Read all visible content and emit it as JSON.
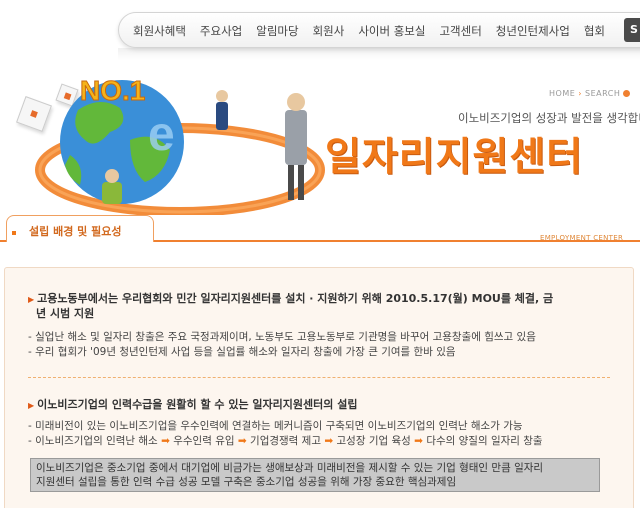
{
  "nav": {
    "items": [
      "회원사혜택",
      "주요사업",
      "알림마당",
      "회원사",
      "사이버 홍보실",
      "고객센터",
      "청년인턴제사업",
      "협회"
    ],
    "button_label": "S"
  },
  "hero": {
    "breadcrumb": [
      "HOME",
      "SEARCH"
    ],
    "slogan": "이노비즈기업의 성장과 발전을 생각합니다",
    "title": "일자리지원센터",
    "badge": "NO.1",
    "globe_letter": "e"
  },
  "section": {
    "tab_label": "설립 배경 및 필요성",
    "side_label": "EMPLOYMENT CENTER"
  },
  "content": {
    "block1": {
      "heading_line1": "고용노동부에서는 우리협회와 민간 일자리지원센터를 설치 · 지원하기 위해 2010.5.17(월) MOU를 체결, 금",
      "heading_line2": "년 시범 지원",
      "bullets": [
        "- 실업난 해소 및 일자리 창출은 주요 국정과제이며, 노동부도 고용노동부로 기관명을 바꾸어 고용창출에 힘쓰고 있음",
        "- 우리 협회가 '09년 청년인턴제 사업 등을 실업률 해소와 일자리 창출에 가장 큰 기여를 한바 있음"
      ]
    },
    "block2": {
      "heading": "이노비즈기업의 인력수급을 원활히 할 수 있는 일자리지원센터의 설립",
      "bullet1": "- 미래비전이 있는 이노비즈기업을 우수인력에 연결하는 메커니즘이 구축되면 이노비즈기업의 인력난 해소가 가능",
      "bullet2_parts": [
        "- 이노비즈기업의 인력난 해소",
        "우수인력 유입",
        "기업경쟁력 제고",
        "고성장 기업 육성",
        "다수의 양질의 일자리 창출"
      ],
      "arrow_glyph": "➡"
    },
    "highlight_line1": "이노비즈기업은 중소기업 중에서 대기업에 비금가는 생애보상과 미래비전을 제시할 수 있는 기업 형태인 만큼 일자리",
    "highlight_line2": "지원센터 설립을 통한 인력 수급 성공 모델 구축은 중소기업 성공을 위해 가장 중요한 핵심과제임"
  },
  "colors": {
    "accent": "#f07818",
    "highlight_bg": "#c9c9c9",
    "content_bg": "#fdf6ef"
  }
}
